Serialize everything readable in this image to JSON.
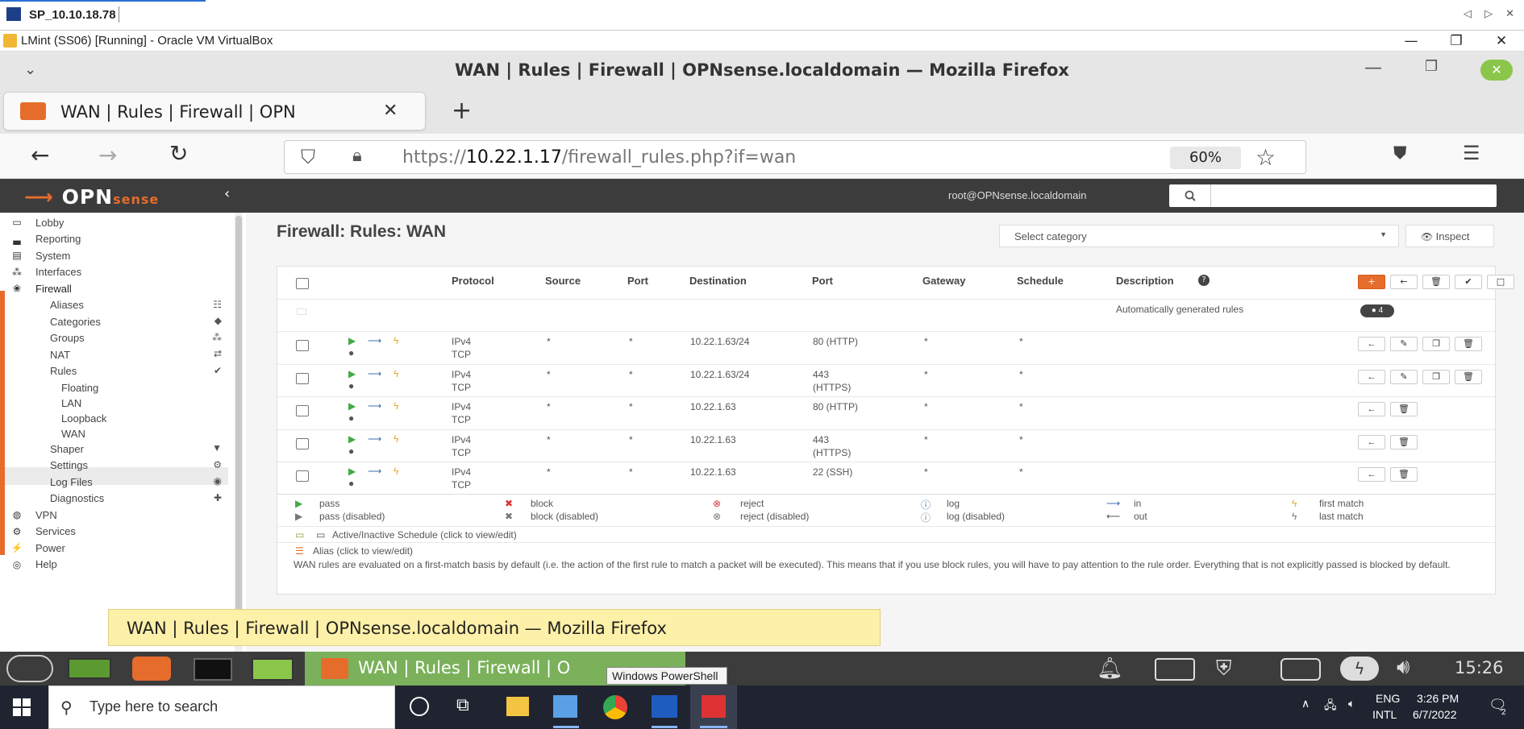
{
  "rdp_title": "SP_10.10.18.78",
  "vbox_title": "LMint (SS06) [Running] - Oracle VM VirtualBox",
  "firefox_title": "WAN | Rules | Firewall | OPNsense.localdomain — Mozilla Firefox",
  "tab_label": "WAN | Rules | Firewall | OPN",
  "url": {
    "prefix": "https://",
    "host": "10.22.1.17",
    "path": "/firewall_rules.php?if=wan"
  },
  "zoom": "60%",
  "opn": {
    "logo_main": "OPN",
    "logo_sub": "sense",
    "user": "root@OPNsense.localdomain"
  },
  "sidebar": [
    {
      "label": "Lobby",
      "icon": "laptop-icon",
      "level": 0
    },
    {
      "label": "Reporting",
      "icon": "chart-icon",
      "level": 0
    },
    {
      "label": "System",
      "icon": "server-icon",
      "level": 0
    },
    {
      "label": "Interfaces",
      "icon": "sitemap-icon",
      "level": 0
    },
    {
      "label": "Firewall",
      "icon": "fire-icon",
      "level": 0,
      "active": true
    },
    {
      "label": "Aliases",
      "icon": "list-icon",
      "level": 1
    },
    {
      "label": "Categories",
      "icon": "tags-icon",
      "level": 1
    },
    {
      "label": "Groups",
      "icon": "sitemap-icon",
      "level": 1
    },
    {
      "label": "NAT",
      "icon": "exchange-icon",
      "level": 1
    },
    {
      "label": "Rules",
      "icon": "check-icon",
      "level": 1
    },
    {
      "label": "Floating",
      "icon": "",
      "level": 2
    },
    {
      "label": "LAN",
      "icon": "",
      "level": 2
    },
    {
      "label": "Loopback",
      "icon": "",
      "level": 2
    },
    {
      "label": "WAN",
      "icon": "",
      "level": 2,
      "selected": true
    },
    {
      "label": "Shaper",
      "icon": "filter-icon",
      "level": 1
    },
    {
      "label": "Settings",
      "icon": "cogs-icon",
      "level": 1
    },
    {
      "label": "Log Files",
      "icon": "eye-icon",
      "level": 1
    },
    {
      "label": "Diagnostics",
      "icon": "medkit-icon",
      "level": 1
    },
    {
      "label": "VPN",
      "icon": "globe-icon",
      "level": 0
    },
    {
      "label": "Services",
      "icon": "cog-icon",
      "level": 0
    },
    {
      "label": "Power",
      "icon": "plug-icon",
      "level": 0
    },
    {
      "label": "Help",
      "icon": "lifesaver-icon",
      "level": 0
    }
  ],
  "page_title": "Firewall: Rules: WAN",
  "select_category": "Select category",
  "inspect": "Inspect",
  "headers": {
    "protocol": "Protocol",
    "source": "Source",
    "port": "Port",
    "destination": "Destination",
    "dport": "Port",
    "gateway": "Gateway",
    "schedule": "Schedule",
    "description": "Description"
  },
  "auto_rules": {
    "text": "Automatically generated rules",
    "count": "4"
  },
  "rules": [
    {
      "proto1": "IPv4",
      "proto2": "TCP",
      "src": "*",
      "sport": "*",
      "dst": "10.22.1.63/24",
      "dport": "80 (HTTP)",
      "dport2": "",
      "gw": "*",
      "sched": "*"
    },
    {
      "proto1": "IPv4",
      "proto2": "TCP",
      "src": "*",
      "sport": "*",
      "dst": "10.22.1.63/24",
      "dport": "443",
      "dport2": "(HTTPS)",
      "gw": "*",
      "sched": "*"
    },
    {
      "proto1": "IPv4",
      "proto2": "TCP",
      "src": "*",
      "sport": "*",
      "dst": "10.22.1.63",
      "dport": "80 (HTTP)",
      "dport2": "",
      "gw": "*",
      "sched": "*"
    },
    {
      "proto1": "IPv4",
      "proto2": "TCP",
      "src": "*",
      "sport": "*",
      "dst": "10.22.1.63",
      "dport": "443",
      "dport2": "(HTTPS)",
      "gw": "*",
      "sched": "*"
    },
    {
      "proto1": "IPv4",
      "proto2": "TCP",
      "src": "*",
      "sport": "*",
      "dst": "10.22.1.63",
      "dport": "22 (SSH)",
      "dport2": "",
      "gw": "*",
      "sched": "*"
    }
  ],
  "legend": {
    "pass": "pass",
    "pass_d": "pass (disabled)",
    "block": "block",
    "block_d": "block (disabled)",
    "reject": "reject",
    "reject_d": "reject (disabled)",
    "log": "log",
    "log_d": "log (disabled)",
    "in": "in",
    "out": "out",
    "first": "first match",
    "last": "last match"
  },
  "schedule_note": "Active/Inactive Schedule (click to view/edit)",
  "alias_note": "Alias (click to view/edit)",
  "wan_note": "WAN rules are evaluated on a first-match basis by default (i.e. the action of the first rule to match a packet will be executed). This means that if you use block rules, you will have to pay attention to the rule order. Everything that is not explicitly passed is blocked by default.",
  "tooltip": "WAN | Rules | Firewall | OPNsense.localdomain — Mozilla Firefox",
  "mint_task": "WAN | Rules | Firewall | O",
  "mint_clock": "15:26",
  "pw_tooltip": "Windows PowerShell",
  "win_search": "Type here to search",
  "tray": {
    "lang1": "ENG",
    "lang2": "INTL",
    "time": "3:26 PM",
    "date": "6/7/2022",
    "notif": "2"
  }
}
